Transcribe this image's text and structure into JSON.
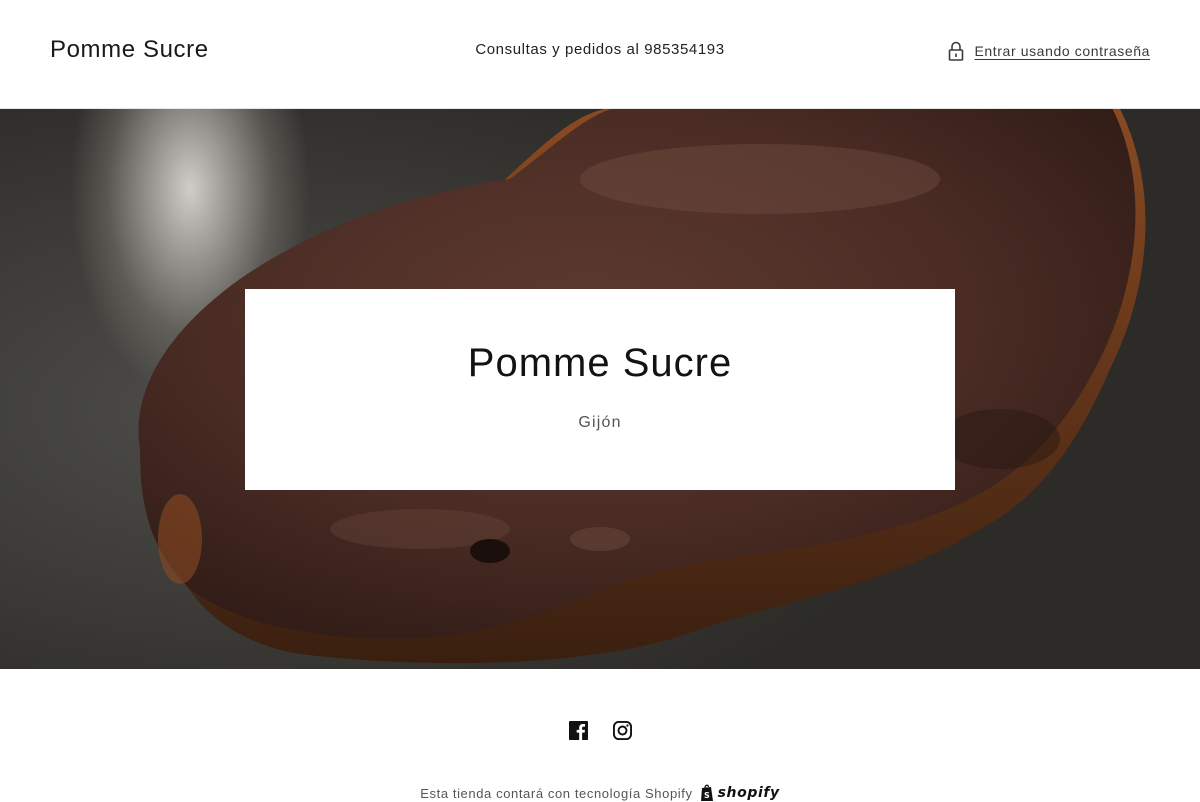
{
  "header": {
    "brand": "Pomme Sucre",
    "contact": "Consultas y pedidos al 985354193",
    "login": {
      "label": "Entrar usando contraseña",
      "icon": "lock-icon"
    }
  },
  "hero": {
    "title": "Pomme Sucre",
    "subtitle": "Gijón",
    "image": "chocolate-covered-palmier-pastry"
  },
  "footer": {
    "social": [
      {
        "name": "Facebook",
        "icon": "facebook-icon"
      },
      {
        "name": "Instagram",
        "icon": "instagram-icon"
      }
    ],
    "powered_text": "Esta tienda contará con tecnología Shopify",
    "shopify_wordmark": "shopify"
  },
  "colors": {
    "text": "#121212",
    "muted": "#555555",
    "background": "#ffffff",
    "chocolate": "#4a2a22"
  }
}
